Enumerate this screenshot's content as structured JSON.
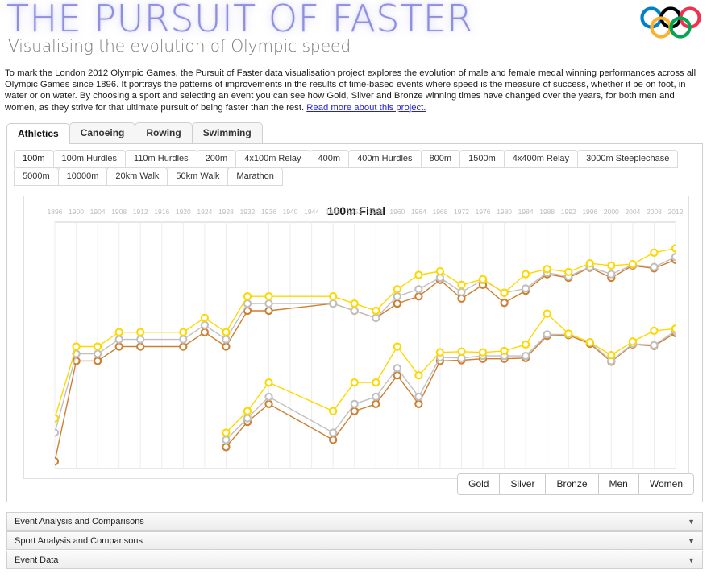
{
  "header": {
    "title": "THE PURSUIT OF FASTER",
    "subtitle": "Visualising the evolution of Olympic speed",
    "logo_icon": "olympic-rings-icon",
    "title_color": "#8f8fe0"
  },
  "intro": {
    "text": "To mark the London 2012 Olympic Games, the Pursuit of Faster data visualisation project explores the evolution of male and female medal winning performances across all Olympic Games since 1896. It portrays the patterns of improvements in the results of time-based events where speed is the measure of success, whether it be on foot, in water or on water. By choosing a sport and selecting an event you can see how Gold, Silver and Bronze winning times have changed over the years, for both men and women, as they strive for that ultimate pursuit of being faster than the rest. ",
    "link_text": "Read more about this project.",
    "link_color": "#2222cc"
  },
  "sport_tabs": [
    {
      "label": "Athletics",
      "active": true
    },
    {
      "label": "Canoeing",
      "active": false
    },
    {
      "label": "Rowing",
      "active": false
    },
    {
      "label": "Swimming",
      "active": false
    }
  ],
  "event_tabs": [
    {
      "label": "100m",
      "active": true
    },
    {
      "label": "100m Hurdles",
      "active": false
    },
    {
      "label": "110m Hurdles",
      "active": false
    },
    {
      "label": "200m",
      "active": false
    },
    {
      "label": "4x100m Relay",
      "active": false
    },
    {
      "label": "400m",
      "active": false
    },
    {
      "label": "400m Hurdles",
      "active": false
    },
    {
      "label": "800m",
      "active": false
    },
    {
      "label": "1500m",
      "active": false
    },
    {
      "label": "4x400m Relay",
      "active": false
    },
    {
      "label": "3000m Steeplechase",
      "active": false
    },
    {
      "label": "5000m",
      "active": false
    },
    {
      "label": "10000m",
      "active": false
    },
    {
      "label": "20km Walk",
      "active": false
    },
    {
      "label": "50km Walk",
      "active": false
    },
    {
      "label": "Marathon",
      "active": false
    }
  ],
  "legend_buttons": [
    {
      "label": "Gold"
    },
    {
      "label": "Silver"
    },
    {
      "label": "Bronze"
    },
    {
      "label": "Men"
    },
    {
      "label": "Women"
    }
  ],
  "accordions": [
    {
      "label": "Event Analysis and Comparisons",
      "chevron": "chevron-down-icon"
    },
    {
      "label": "Sport Analysis and Comparisons",
      "chevron": "chevron-down-icon"
    },
    {
      "label": "Event Data",
      "chevron": "chevron-down-icon"
    }
  ],
  "chart_data": {
    "type": "line",
    "title": "100m Final",
    "xlabel": "",
    "ylabel": "",
    "grid": true,
    "legend_position": "bottom-right",
    "colors": {
      "gold": "#FFD700",
      "silver": "#C0C0C0",
      "bronze": "#CD7F32"
    },
    "x": [
      1896,
      1900,
      1904,
      1908,
      1912,
      1920,
      1924,
      1928,
      1932,
      1936,
      1948,
      1952,
      1956,
      1960,
      1964,
      1968,
      1972,
      1976,
      1980,
      1984,
      1988,
      1992,
      1996,
      2000,
      2004,
      2008,
      2012
    ],
    "xticks": [
      1896,
      1900,
      1904,
      1908,
      1912,
      1916,
      1920,
      1924,
      1928,
      1932,
      1936,
      1940,
      1944,
      1948,
      1952,
      1956,
      1960,
      1964,
      1968,
      1972,
      1976,
      1980,
      1984,
      1988,
      1992,
      1996,
      2000,
      2004,
      2008,
      2012
    ],
    "series": [
      {
        "name": "Men Gold",
        "group": "Men",
        "medal": "Gold",
        "color": "#FFD700",
        "x": [
          1896,
          1900,
          1904,
          1908,
          1912,
          1920,
          1924,
          1928,
          1932,
          1936,
          1948,
          1952,
          1956,
          1960,
          1964,
          1968,
          1972,
          1976,
          1980,
          1984,
          1988,
          1992,
          1996,
          2000,
          2004,
          2008,
          2012
        ],
        "values": [
          12.0,
          11.0,
          11.0,
          10.8,
          10.8,
          10.8,
          10.6,
          10.8,
          10.3,
          10.3,
          10.3,
          10.4,
          10.5,
          10.2,
          10.0,
          9.95,
          10.14,
          10.06,
          10.25,
          9.99,
          9.92,
          9.96,
          9.84,
          9.87,
          9.85,
          9.69,
          9.63
        ]
      },
      {
        "name": "Men Silver",
        "group": "Men",
        "medal": "Silver",
        "color": "#C0C0C0",
        "x": [
          1896,
          1900,
          1904,
          1908,
          1912,
          1920,
          1924,
          1928,
          1932,
          1936,
          1948,
          1952,
          1956,
          1960,
          1964,
          1968,
          1972,
          1976,
          1980,
          1984,
          1988,
          1992,
          1996,
          2000,
          2004,
          2008,
          2012
        ],
        "values": [
          12.2,
          11.1,
          11.1,
          10.9,
          10.9,
          10.9,
          10.7,
          10.9,
          10.4,
          10.4,
          10.4,
          10.5,
          10.6,
          10.3,
          10.2,
          10.04,
          10.24,
          10.07,
          10.25,
          10.19,
          9.97,
          10.02,
          9.89,
          9.99,
          9.86,
          9.89,
          9.75
        ]
      },
      {
        "name": "Men Bronze",
        "group": "Men",
        "medal": "Bronze",
        "color": "#CD7F32",
        "x": [
          1896,
          1900,
          1904,
          1908,
          1912,
          1920,
          1924,
          1928,
          1932,
          1936,
          1948,
          1952,
          1956,
          1960,
          1964,
          1968,
          1972,
          1976,
          1980,
          1984,
          1988,
          1992,
          1996,
          2000,
          2004,
          2008,
          2012
        ],
        "values": [
          12.6,
          11.2,
          11.2,
          11.0,
          11.0,
          11.0,
          10.8,
          11.0,
          10.5,
          10.5,
          10.4,
          10.5,
          10.6,
          10.4,
          10.3,
          10.07,
          10.33,
          10.14,
          10.39,
          10.22,
          9.99,
          10.04,
          9.9,
          10.04,
          9.87,
          9.91,
          9.79
        ]
      },
      {
        "name": "Women Gold",
        "group": "Women",
        "medal": "Gold",
        "color": "#FFD700",
        "x": [
          1928,
          1932,
          1936,
          1948,
          1952,
          1956,
          1960,
          1964,
          1968,
          1972,
          1976,
          1980,
          1984,
          1988,
          1992,
          1996,
          2000,
          2004,
          2008,
          2012
        ],
        "values": [
          12.2,
          11.9,
          11.5,
          11.9,
          11.5,
          11.5,
          11.0,
          11.4,
          11.08,
          11.07,
          11.08,
          11.06,
          10.97,
          10.54,
          10.82,
          10.94,
          11.12,
          10.93,
          10.78,
          10.75
        ]
      },
      {
        "name": "Women Silver",
        "group": "Women",
        "medal": "Silver",
        "color": "#C0C0C0",
        "x": [
          1928,
          1932,
          1936,
          1948,
          1952,
          1956,
          1960,
          1964,
          1968,
          1972,
          1976,
          1980,
          1984,
          1988,
          1992,
          1996,
          2000,
          2004,
          2008,
          2012
        ],
        "values": [
          12.3,
          12.0,
          11.7,
          12.2,
          11.8,
          11.7,
          11.3,
          11.7,
          11.15,
          11.16,
          11.13,
          11.13,
          11.13,
          10.83,
          10.83,
          10.94,
          11.2,
          10.96,
          10.98,
          10.78
        ]
      },
      {
        "name": "Women Bronze",
        "group": "Women",
        "medal": "Bronze",
        "color": "#CD7F32",
        "x": [
          1928,
          1932,
          1936,
          1948,
          1952,
          1956,
          1960,
          1964,
          1968,
          1972,
          1976,
          1980,
          1984,
          1988,
          1992,
          1996,
          2000,
          2004,
          2008,
          2012
        ],
        "values": [
          12.4,
          12.05,
          11.8,
          12.3,
          11.9,
          11.8,
          11.4,
          11.8,
          11.2,
          11.19,
          11.17,
          11.17,
          11.16,
          10.85,
          10.84,
          10.96,
          11.21,
          10.97,
          10.99,
          10.81
        ]
      }
    ]
  }
}
